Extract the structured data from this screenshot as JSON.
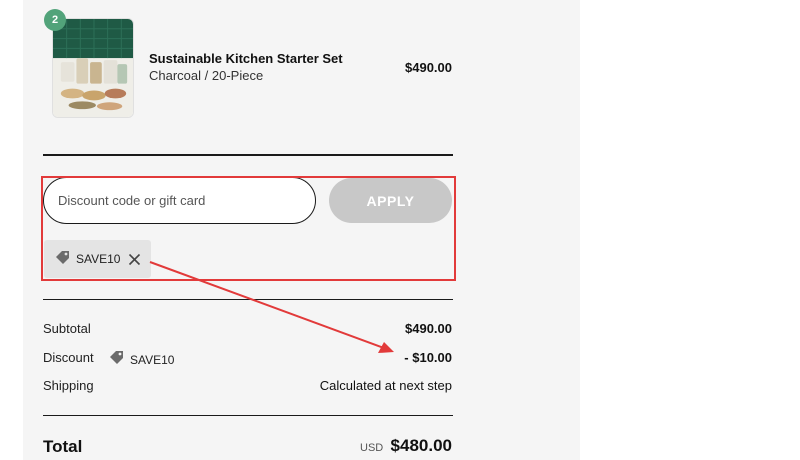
{
  "product": {
    "quantity": "2",
    "name": "Sustainable Kitchen Starter Set",
    "variant": "Charcoal / 20-Piece",
    "price": "$490.00"
  },
  "discount": {
    "input_placeholder": "Discount code or gift card",
    "apply_label": "APPLY",
    "applied_code": "SAVE10"
  },
  "summary": {
    "subtotal_label": "Subtotal",
    "subtotal_value": "$490.00",
    "discount_label": "Discount",
    "discount_code": "SAVE10",
    "discount_value": "- $10.00",
    "shipping_label": "Shipping",
    "shipping_value": "Calculated at next step",
    "total_label": "Total",
    "currency": "USD",
    "total_value": "$480.00"
  },
  "colors": {
    "panel_bg": "#f5f5f5",
    "apply_button": "#c8c8c8",
    "annotation": "#e23a3a",
    "badge": "#52a37a"
  },
  "icons": [
    "tag-icon",
    "close-icon"
  ]
}
